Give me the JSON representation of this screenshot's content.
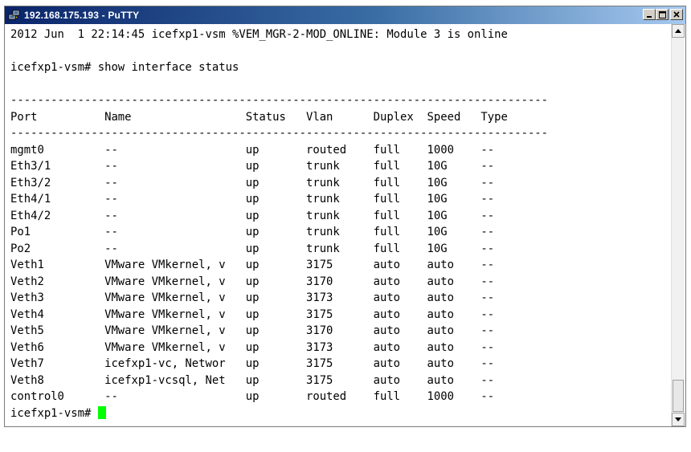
{
  "window": {
    "title": "192.168.175.193 - PuTTY",
    "icon": "putty-computers-icon",
    "minimize_label": "_",
    "maximize_label": "□",
    "close_label": "×"
  },
  "terminal": {
    "lines": [
      "2012 Jun  1 22:14:45 icefxp1-vsm %VEM_MGR-2-MOD_ONLINE: Module 3 is online",
      "",
      "icefxp1-vsm# show interface status",
      "",
      "--------------------------------------------------------------------------------",
      "Port          Name                 Status   Vlan      Duplex  Speed   Type",
      "--------------------------------------------------------------------------------",
      "mgmt0         --                   up       routed    full    1000    --",
      "Eth3/1        --                   up       trunk     full    10G     --",
      "Eth3/2        --                   up       trunk     full    10G     --",
      "Eth4/1        --                   up       trunk     full    10G     --",
      "Eth4/2        --                   up       trunk     full    10G     --",
      "Po1           --                   up       trunk     full    10G     --",
      "Po2           --                   up       trunk     full    10G     --",
      "Veth1         VMware VMkernel, v   up       3175      auto    auto    --",
      "Veth2         VMware VMkernel, v   up       3170      auto    auto    --",
      "Veth3         VMware VMkernel, v   up       3173      auto    auto    --",
      "Veth4         VMware VMkernel, v   up       3175      auto    auto    --",
      "Veth5         VMware VMkernel, v   up       3170      auto    auto    --",
      "Veth6         VMware VMkernel, v   up       3173      auto    auto    --",
      "Veth7         icefxp1-vc, Networ   up       3175      auto    auto    --",
      "Veth8         icefxp1-vcsql, Net   up       3175      auto    auto    --",
      "control0      --                   up       routed    full    1000    --"
    ],
    "prompt": "icefxp1-vsm# ",
    "cursor_color": "#00ff00"
  },
  "colors": {
    "terminal_bg": "#ffffff",
    "terminal_fg": "#000000",
    "titlebar_start": "#0a246a",
    "titlebar_end": "#a6caf0"
  }
}
